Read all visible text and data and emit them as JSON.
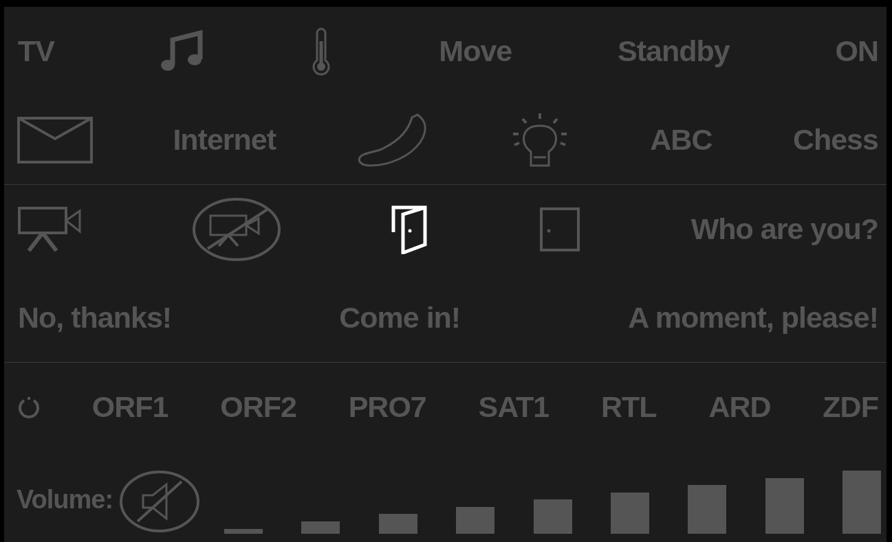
{
  "sections": [
    {
      "rows": [
        {
          "items": [
            {
              "kind": "text",
              "label": "TV",
              "selected": false
            },
            {
              "kind": "music",
              "selected": false
            },
            {
              "kind": "thermometer",
              "selected": false
            },
            {
              "kind": "text",
              "label": "Move",
              "selected": false
            },
            {
              "kind": "text",
              "label": "Standby",
              "selected": false
            },
            {
              "kind": "text",
              "label": "ON",
              "selected": false
            }
          ]
        },
        {
          "items": [
            {
              "kind": "mail",
              "selected": false
            },
            {
              "kind": "text",
              "label": "Internet",
              "selected": false
            },
            {
              "kind": "phone",
              "selected": false
            },
            {
              "kind": "bulb",
              "selected": false
            },
            {
              "kind": "text",
              "label": "ABC",
              "selected": false
            },
            {
              "kind": "text",
              "label": "Chess",
              "selected": false
            }
          ]
        }
      ]
    },
    {
      "rows": [
        {
          "items": [
            {
              "kind": "camera",
              "selected": false
            },
            {
              "kind": "camera-off",
              "selected": false
            },
            {
              "kind": "door-open",
              "selected": true
            },
            {
              "kind": "door-closed",
              "selected": false
            },
            {
              "kind": "text",
              "label": "Who are you?",
              "selected": false
            }
          ]
        },
        {
          "items": [
            {
              "kind": "text",
              "label": "No, thanks!",
              "selected": false
            },
            {
              "kind": "text",
              "label": "Come in!",
              "selected": false
            },
            {
              "kind": "text",
              "label": "A moment, please!",
              "selected": false
            }
          ]
        }
      ]
    },
    {
      "rows": [
        {
          "items": [
            {
              "kind": "power",
              "selected": false
            },
            {
              "kind": "text",
              "label": "ORF1",
              "selected": false
            },
            {
              "kind": "text",
              "label": "ORF2",
              "selected": false
            },
            {
              "kind": "text",
              "label": "PRO7",
              "selected": false
            },
            {
              "kind": "text",
              "label": "SAT1",
              "selected": false
            },
            {
              "kind": "text",
              "label": "RTL",
              "selected": false
            },
            {
              "kind": "text",
              "label": "ARD",
              "selected": false
            },
            {
              "kind": "text",
              "label": "ZDF",
              "selected": false
            }
          ]
        }
      ]
    }
  ],
  "volume": {
    "label": "Volume:",
    "mute": {
      "selected": false
    },
    "steps": [
      {
        "selected": false
      },
      {
        "selected": false
      },
      {
        "selected": false
      },
      {
        "selected": false
      },
      {
        "selected": false
      },
      {
        "selected": false
      },
      {
        "selected": false
      },
      {
        "selected": false
      },
      {
        "selected": false
      }
    ]
  }
}
